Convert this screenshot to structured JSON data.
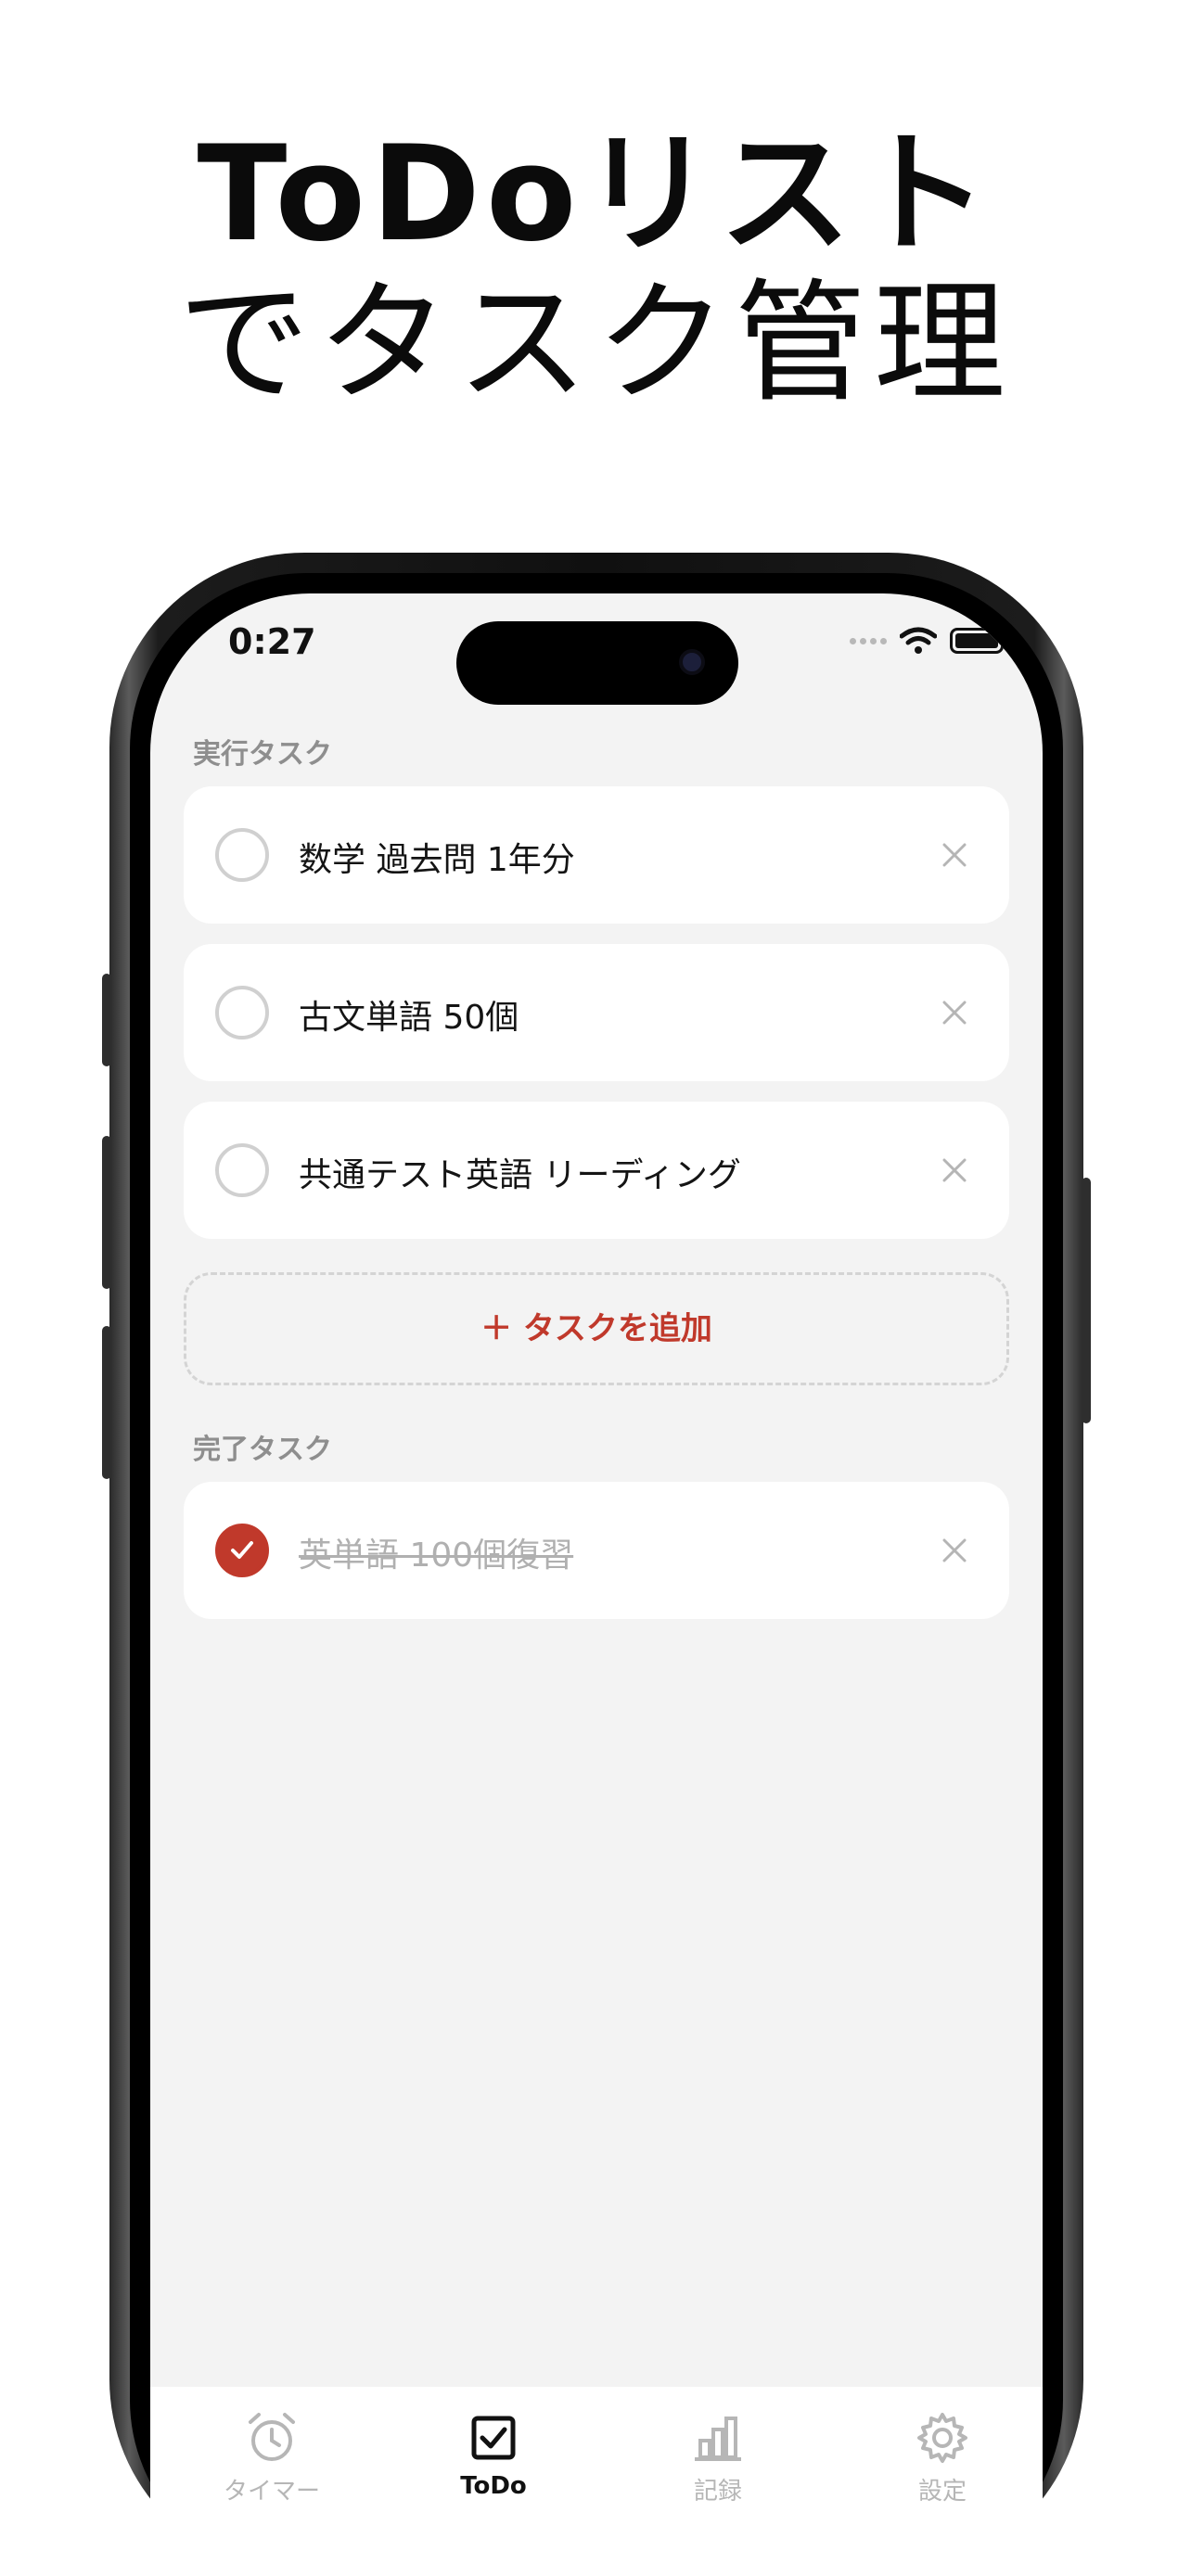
{
  "headline": {
    "line1": "ToDoリスト",
    "line2": "でタスク管理"
  },
  "status_bar": {
    "time": "0:27"
  },
  "sections": {
    "active_label": "実行タスク",
    "completed_label": "完了タスク"
  },
  "active_tasks": [
    {
      "title": "数学 過去問 1年分"
    },
    {
      "title": "古文単語 50個"
    },
    {
      "title": "共通テスト英語 リーディング"
    }
  ],
  "add_button": {
    "label": "＋ タスクを追加"
  },
  "completed_tasks": [
    {
      "title": "英単語 100個復習"
    }
  ],
  "tabbar": {
    "tabs": [
      {
        "label": "タイマー",
        "icon": "alarm-clock-icon"
      },
      {
        "label": "ToDo",
        "icon": "checkbox-icon",
        "active": true
      },
      {
        "label": "記録",
        "icon": "bar-chart-icon"
      },
      {
        "label": "設定",
        "icon": "gear-icon"
      }
    ]
  },
  "colors": {
    "accent": "#c0392b",
    "background": "#f3f3f3",
    "muted_text": "#8e8e8e"
  }
}
